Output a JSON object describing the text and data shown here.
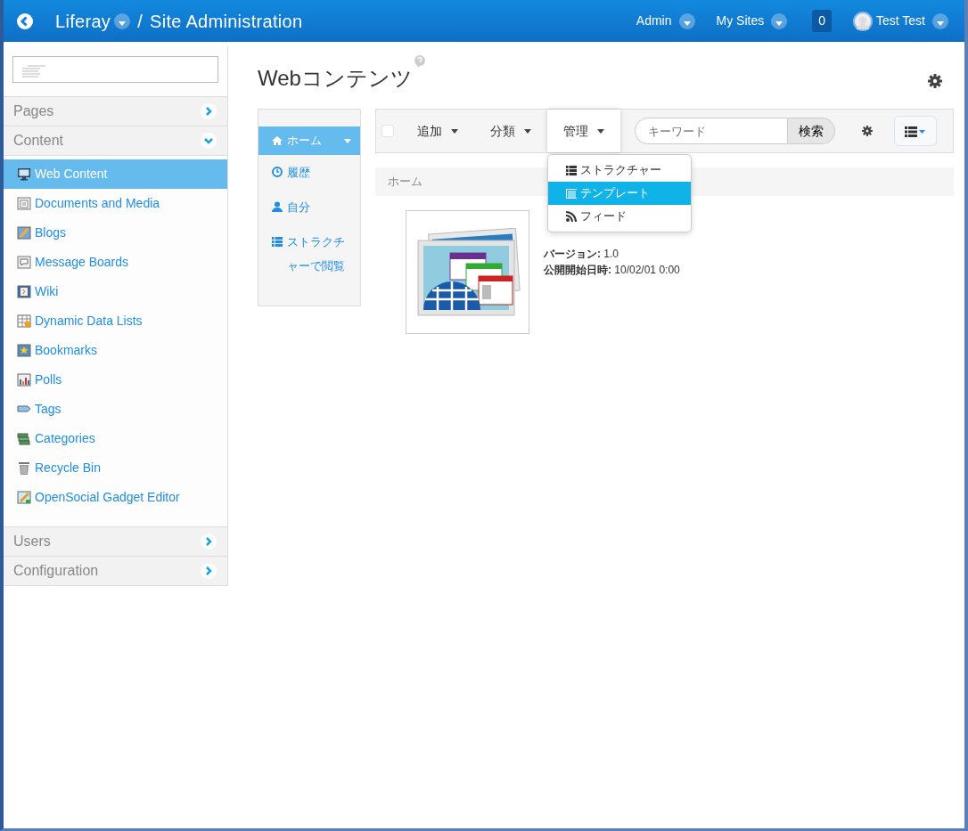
{
  "header": {
    "site": "Liferay",
    "separator": "/",
    "title": "Site Administration",
    "menus": [
      "Admin",
      "My Sites"
    ],
    "notification_count": "0",
    "user": "Test Test"
  },
  "sidebar": {
    "sections": [
      {
        "label": "Pages",
        "expanded": false
      },
      {
        "label": "Content",
        "expanded": true,
        "items": [
          {
            "label": "Web Content",
            "kind": "monitor",
            "selected": true
          },
          {
            "label": "Documents and Media",
            "kind": "document",
            "selected": false
          },
          {
            "label": "Blogs",
            "kind": "pencil",
            "selected": false
          },
          {
            "label": "Message Boards",
            "kind": "bubble",
            "selected": false
          },
          {
            "label": "Wiki",
            "kind": "page",
            "selected": false
          },
          {
            "label": "Dynamic Data Lists",
            "kind": "table",
            "selected": false
          },
          {
            "label": "Bookmarks",
            "kind": "star",
            "selected": false
          },
          {
            "label": "Polls",
            "kind": "bars",
            "selected": false
          },
          {
            "label": "Tags",
            "kind": "tag",
            "selected": false
          },
          {
            "label": "Categories",
            "kind": "stack",
            "selected": false
          },
          {
            "label": "Recycle Bin",
            "kind": "trash",
            "selected": false
          },
          {
            "label": "OpenSocial Gadget Editor",
            "kind": "edit",
            "selected": false
          }
        ]
      },
      {
        "label": "Users",
        "expanded": false
      },
      {
        "label": "Configuration",
        "expanded": false
      }
    ]
  },
  "main": {
    "title": "Webコンテンツ",
    "nav": [
      {
        "label": "ホーム",
        "kind": "home",
        "selected": true
      },
      {
        "label": "履歴",
        "kind": "clock",
        "selected": false
      },
      {
        "label": "自分",
        "kind": "user",
        "selected": false
      },
      {
        "label": "ストラクチャーで閲覧",
        "kind": "structure",
        "selected": false
      }
    ],
    "toolbar": {
      "select_all": {
        "checked": false
      },
      "menus": [
        {
          "label": "追加",
          "open": false
        },
        {
          "label": "分類",
          "open": false
        },
        {
          "label": "管理",
          "open": true
        }
      ],
      "search": {
        "placeholder": "キーワード"
      },
      "search_button": "検索"
    },
    "dropdown": [
      {
        "label": "ストラクチャー",
        "kind": "structure",
        "selected": false
      },
      {
        "label": "テンプレート",
        "kind": "template",
        "selected": true
      },
      {
        "label": "フィード",
        "kind": "feed",
        "selected": false
      }
    ],
    "breadcrumb": "ホーム",
    "entry": {
      "fields": [
        {
          "label": "バージョン:",
          "value": "1.0"
        },
        {
          "label": "公開開始日時:",
          "value": "10/02/01 0:00"
        }
      ]
    }
  }
}
